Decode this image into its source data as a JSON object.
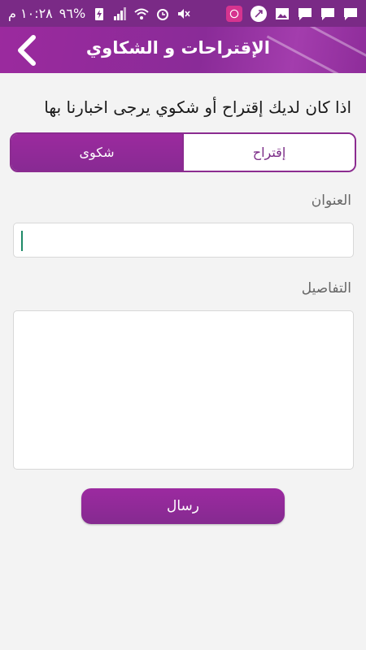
{
  "status_bar": {
    "time": "١٠:٢٨ م",
    "battery": "٩٦%",
    "icons": [
      "charging-icon",
      "signal-icon",
      "wifi-icon",
      "alarm-icon",
      "mute-icon",
      "app-icon",
      "location-icon",
      "image-icon",
      "message-icon",
      "message-icon",
      "message-icon"
    ]
  },
  "header": {
    "title": "الإقتراحات و الشكاوي",
    "back_icon": "chevron-left-icon"
  },
  "form": {
    "prompt": "اذا كان لديك إقتراح أو شكوي يرجى اخبارنا بها",
    "tabs": [
      {
        "label": "إقتراح",
        "selected": false
      },
      {
        "label": "شكوى",
        "selected": true
      }
    ],
    "title_label": "العنوان",
    "title_value": "",
    "details_label": "التفاصيل",
    "details_value": "",
    "submit_label": "رسال"
  },
  "colors": {
    "primary": "#8b2c90",
    "status_bar": "#7a2a86",
    "background": "#f3f3f3"
  }
}
